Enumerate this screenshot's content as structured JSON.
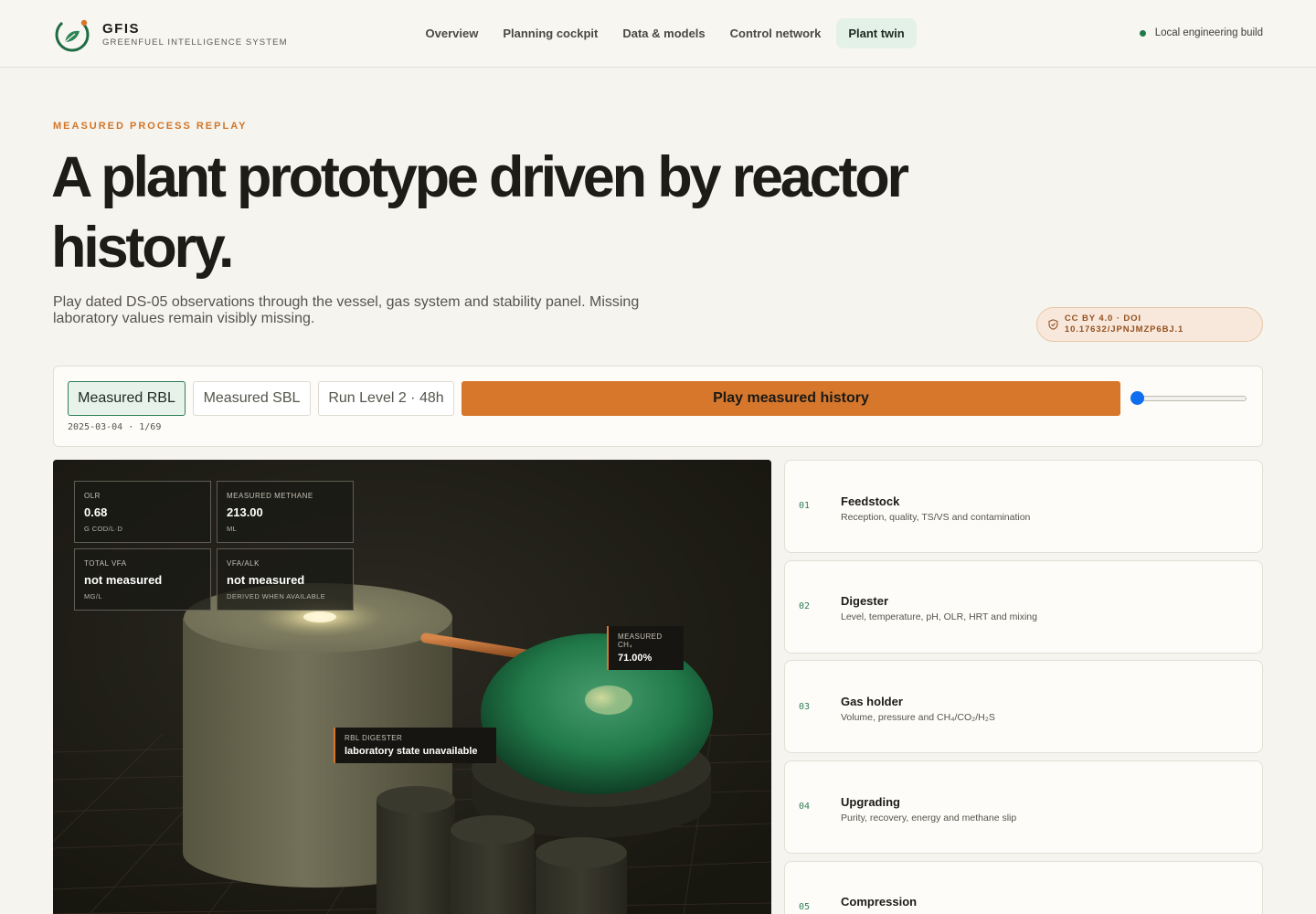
{
  "brand": {
    "name": "GFIS",
    "subtitle": "GREENFUEL INTELLIGENCE SYSTEM"
  },
  "nav": [
    {
      "label": "Overview",
      "active": false
    },
    {
      "label": "Planning cockpit",
      "active": false
    },
    {
      "label": "Data & models",
      "active": false
    },
    {
      "label": "Control network",
      "active": false
    },
    {
      "label": "Plant twin",
      "active": true
    }
  ],
  "build_status": "Local engineering build",
  "hero": {
    "eyebrow": "MEASURED PROCESS REPLAY",
    "headline": "A plant prototype driven by reactor history.",
    "lede": "Play dated DS-05 observations through the vessel, gas system and stability panel. Missing laboratory values remain visibly missing.",
    "license": "CC BY 4.0 · DOI 10.17632/JPNJMZP6BJ.1"
  },
  "controls": {
    "modes": [
      "Measured RBL",
      "Measured SBL",
      "Run Level 2 · 48h"
    ],
    "active_mode": "Measured RBL",
    "play_label": "Play measured history",
    "slider_fraction": 0,
    "date_readout": "2025-03-04 · 1/69"
  },
  "metrics": [
    {
      "label": "OLR",
      "value": "0.68",
      "unit": "G COD/L·D"
    },
    {
      "label": "MEASURED METHANE",
      "value": "213.00",
      "unit": "ML"
    },
    {
      "label": "TOTAL VFA",
      "value": "not measured",
      "unit": "MG/L"
    },
    {
      "label": "VFA/ALK",
      "value": "not measured",
      "unit": "DERIVED WHEN AVAILABLE"
    }
  ],
  "callouts": {
    "ch4": {
      "label": "MEASURED CH₄",
      "value": "71.00%"
    },
    "digester": {
      "label": "RBL DIGESTER",
      "value": "laboratory state unavailable"
    }
  },
  "stages": [
    {
      "num": "01",
      "title": "Feedstock",
      "desc": "Reception, quality, TS/VS and contamination"
    },
    {
      "num": "02",
      "title": "Digester",
      "desc": "Level, temperature, pH, OLR, HRT and mixing"
    },
    {
      "num": "03",
      "title": "Gas holder",
      "desc": "Volume, pressure and CH₄/CO₂/H₂S"
    },
    {
      "num": "04",
      "title": "Upgrading",
      "desc": "Purity, recovery, energy and methane slip"
    },
    {
      "num": "05",
      "title": "Compression",
      "desc": ""
    }
  ],
  "colors": {
    "accent": "#d6772c",
    "brand_green": "#1f7a49",
    "page_bg": "#f6f4ee"
  },
  "icons": {
    "logo": "leaf-ring-icon",
    "license": "shield-icon"
  }
}
